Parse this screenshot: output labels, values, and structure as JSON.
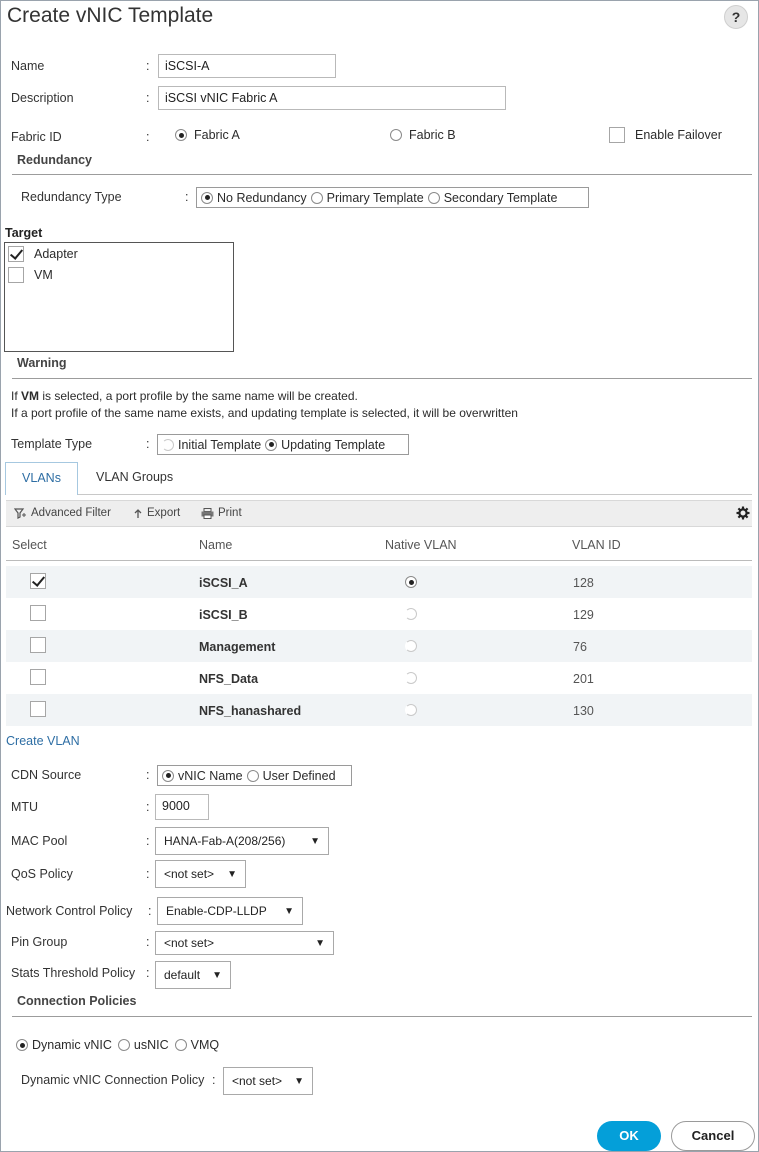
{
  "dialog": {
    "title": "Create vNIC Template",
    "help_label": "?"
  },
  "form": {
    "name_label": "Name",
    "name_value": "iSCSI-A",
    "description_label": "Description",
    "description_value": "iSCSI vNIC Fabric A",
    "fabric_id_label": "Fabric ID",
    "fabric_a": "Fabric A",
    "fabric_b": "Fabric B",
    "fabric_selected": "Fabric A",
    "enable_failover": "Enable Failover",
    "enable_failover_checked": false
  },
  "redundancy": {
    "section_title": "Redundancy",
    "type_label": "Redundancy Type",
    "options": [
      "No Redundancy",
      "Primary Template",
      "Secondary Template"
    ],
    "selected": "No Redundancy"
  },
  "target": {
    "section_title": "Target",
    "items": [
      {
        "label": "Adapter",
        "checked": true
      },
      {
        "label": "VM",
        "checked": false
      }
    ]
  },
  "warning": {
    "section_title": "Warning",
    "line1_prefix": "If ",
    "line1_bold": "VM",
    "line1_suffix": " is selected, a port profile by the same name will be created.",
    "line2": "If a port profile of the same name exists, and updating template is selected, it will be overwritten"
  },
  "template_type": {
    "label": "Template Type",
    "options": [
      "Initial Template",
      "Updating Template"
    ],
    "selected": "Updating Template"
  },
  "tabs": [
    {
      "label": "VLANs",
      "active": true
    },
    {
      "label": "VLAN Groups",
      "active": false
    }
  ],
  "toolbar": {
    "advanced_filter": "Advanced Filter",
    "export": "Export",
    "print": "Print"
  },
  "vlan_table": {
    "columns": [
      "Select",
      "Name",
      "Native VLAN",
      "VLAN ID"
    ],
    "rows": [
      {
        "selected": true,
        "name": "iSCSI_A",
        "native": true,
        "vlan_id": "128"
      },
      {
        "selected": false,
        "name": "iSCSI_B",
        "native": false,
        "vlan_id": "129"
      },
      {
        "selected": false,
        "name": "Management",
        "native": false,
        "vlan_id": "76"
      },
      {
        "selected": false,
        "name": "NFS_Data",
        "native": false,
        "vlan_id": "201"
      },
      {
        "selected": false,
        "name": "NFS_hanashared",
        "native": false,
        "vlan_id": "130"
      }
    ]
  },
  "create_vlan": "Create VLAN",
  "cdn": {
    "label": "CDN Source",
    "options": [
      "vNIC Name",
      "User Defined"
    ],
    "selected": "vNIC Name"
  },
  "mtu": {
    "label": "MTU",
    "value": "9000"
  },
  "mac_pool": {
    "label": "MAC Pool",
    "value": "HANA-Fab-A(208/256)"
  },
  "qos_policy": {
    "label": "QoS Policy",
    "value": "<not set>"
  },
  "network_control_policy": {
    "label": "Network Control Policy",
    "value": "Enable-CDP-LLDP"
  },
  "pin_group": {
    "label": "Pin Group",
    "value": "<not set>"
  },
  "stats_threshold_policy": {
    "label": "Stats Threshold Policy",
    "value": "default"
  },
  "connection_policies": {
    "section_title": "Connection Policies",
    "options": [
      "Dynamic vNIC",
      "usNIC",
      "VMQ"
    ],
    "selected": "Dynamic vNIC",
    "dynamic_policy_label": "Dynamic vNIC Connection Policy",
    "dynamic_policy_value": "<not set>"
  },
  "buttons": {
    "ok": "OK",
    "cancel": "Cancel"
  },
  "colors": {
    "accent": "#049fd9",
    "link": "#2e6ea4",
    "row_alt": "#f1f4f6"
  }
}
